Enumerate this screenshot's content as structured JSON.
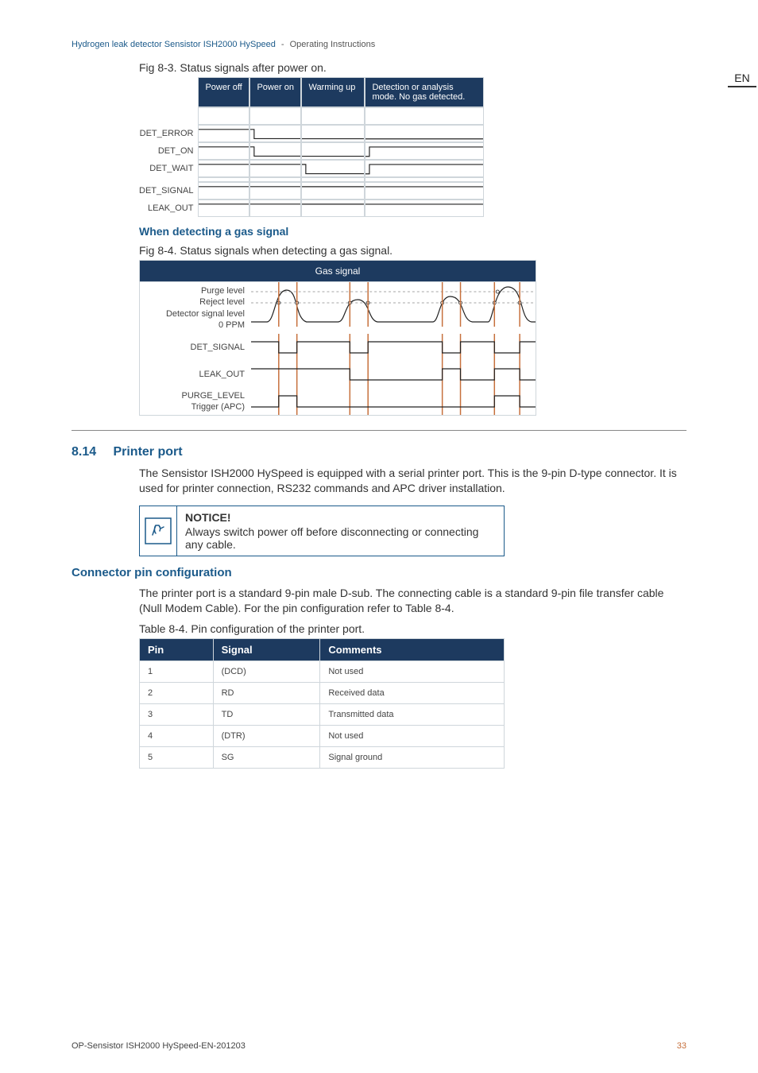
{
  "header": {
    "product": "Hydrogen leak detector Sensistor ISH2000 HySpeed",
    "section": "Operating Instructions"
  },
  "lang": "EN",
  "fig83": {
    "caption": "Fig 8-3. Status signals after power on.",
    "cols": [
      "Power off",
      "Power on",
      "Warming up",
      "Detection or analysis mode. No gas detected."
    ],
    "rows": [
      "DET_ERROR",
      "DET_ON",
      "DET_WAIT",
      "DET_SIGNAL",
      "LEAK_OUT"
    ]
  },
  "when_heading": "When detecting a gas signal",
  "fig84": {
    "caption": "Fig 8-4. Status signals when detecting a gas signal.",
    "head": "Gas signal",
    "rows": [
      {
        "labels": [
          "Purge level",
          "Reject level",
          "",
          "Detector signal level",
          "0 PPM"
        ],
        "type": "analog"
      },
      {
        "labels": [
          "DET_SIGNAL"
        ],
        "type": "det_signal"
      },
      {
        "labels": [
          "LEAK_OUT"
        ],
        "type": "leak_out"
      },
      {
        "labels": [
          "PURGE_LEVEL",
          "Trigger (APC)"
        ],
        "type": "purge"
      }
    ]
  },
  "sec": {
    "num": "8.14",
    "title": "Printer port",
    "p1": "The Sensistor ISH2000 HySpeed is equipped with a serial printer port. This is the 9-pin D-type connector. It is used for printer connection, RS232 commands and APC driver installation."
  },
  "notice": {
    "head": "NOTICE!",
    "body": "Always switch power off before disconnecting or connecting any cable."
  },
  "conn": {
    "title": "Connector pin configuration",
    "p": "The printer port is a standard 9-pin male D-sub. The connecting cable is a standard 9-pin file transfer cable (Null Modem Cable). For the pin configuration refer to Table 8-4.",
    "caption": "Table 8-4. Pin configuration of the printer port.",
    "headers": [
      "Pin",
      "Signal",
      "Comments"
    ],
    "rows": [
      [
        "1",
        "(DCD)",
        "Not used"
      ],
      [
        "2",
        "RD",
        "Received data"
      ],
      [
        "3",
        "TD",
        "Transmitted data"
      ],
      [
        "4",
        "(DTR)",
        "Not used"
      ],
      [
        "5",
        "SG",
        "Signal ground"
      ]
    ]
  },
  "footer": {
    "doc": "OP-Sensistor ISH2000 HySpeed-EN-201203",
    "page": "33"
  }
}
